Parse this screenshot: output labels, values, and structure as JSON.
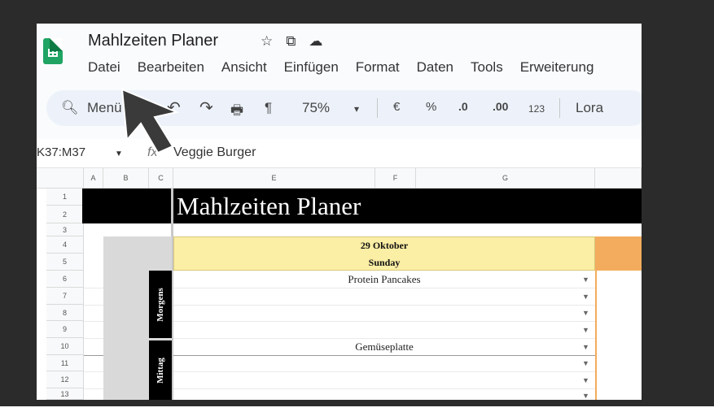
{
  "doc": {
    "title": "Mahlzeiten Planer",
    "title_icons": [
      "star-icon",
      "move-to-folder-icon",
      "cloud-status-icon"
    ]
  },
  "menu": [
    "Datei",
    "Bearbeiten",
    "Ansicht",
    "Einfügen",
    "Format",
    "Daten",
    "Tools",
    "Erweiterung"
  ],
  "toolbar": {
    "search_label": "Menü",
    "undo": "↶",
    "redo": "↷",
    "print": "🖶",
    "paint": "¶",
    "zoom": "75%",
    "zoom_caret": "▾",
    "currency": "€",
    "percent": "%",
    "dec_decrease": ".0",
    "dec_increase": ".00",
    "format_number": "123",
    "font": "Lora"
  },
  "formula_bar": {
    "name_box": "K37:M37",
    "fx": "fx",
    "value": "Veggie Burger"
  },
  "columns": [
    "A",
    "B",
    "C",
    "E",
    "F",
    "G"
  ],
  "rows": [
    "1",
    "2",
    "3",
    "4",
    "5",
    "6",
    "7",
    "8",
    "9",
    "10",
    "11",
    "12",
    "13"
  ],
  "sheet": {
    "main_title": "Mahlzeiten Planer",
    "day": {
      "date": "29 Oktober",
      "weekday": "Sunday"
    },
    "sections": [
      {
        "label": "Morgens",
        "meals": [
          "Protein Pancakes",
          "",
          "",
          ""
        ]
      },
      {
        "label": "Mittag",
        "meals": [
          "Gemüseplatte",
          "",
          "",
          ""
        ]
      }
    ]
  },
  "colors": {
    "sheets_green": "#1fa463",
    "header_yellow": "#fbeea5",
    "header_orange": "#f3ac5d",
    "title_black": "#000000"
  }
}
